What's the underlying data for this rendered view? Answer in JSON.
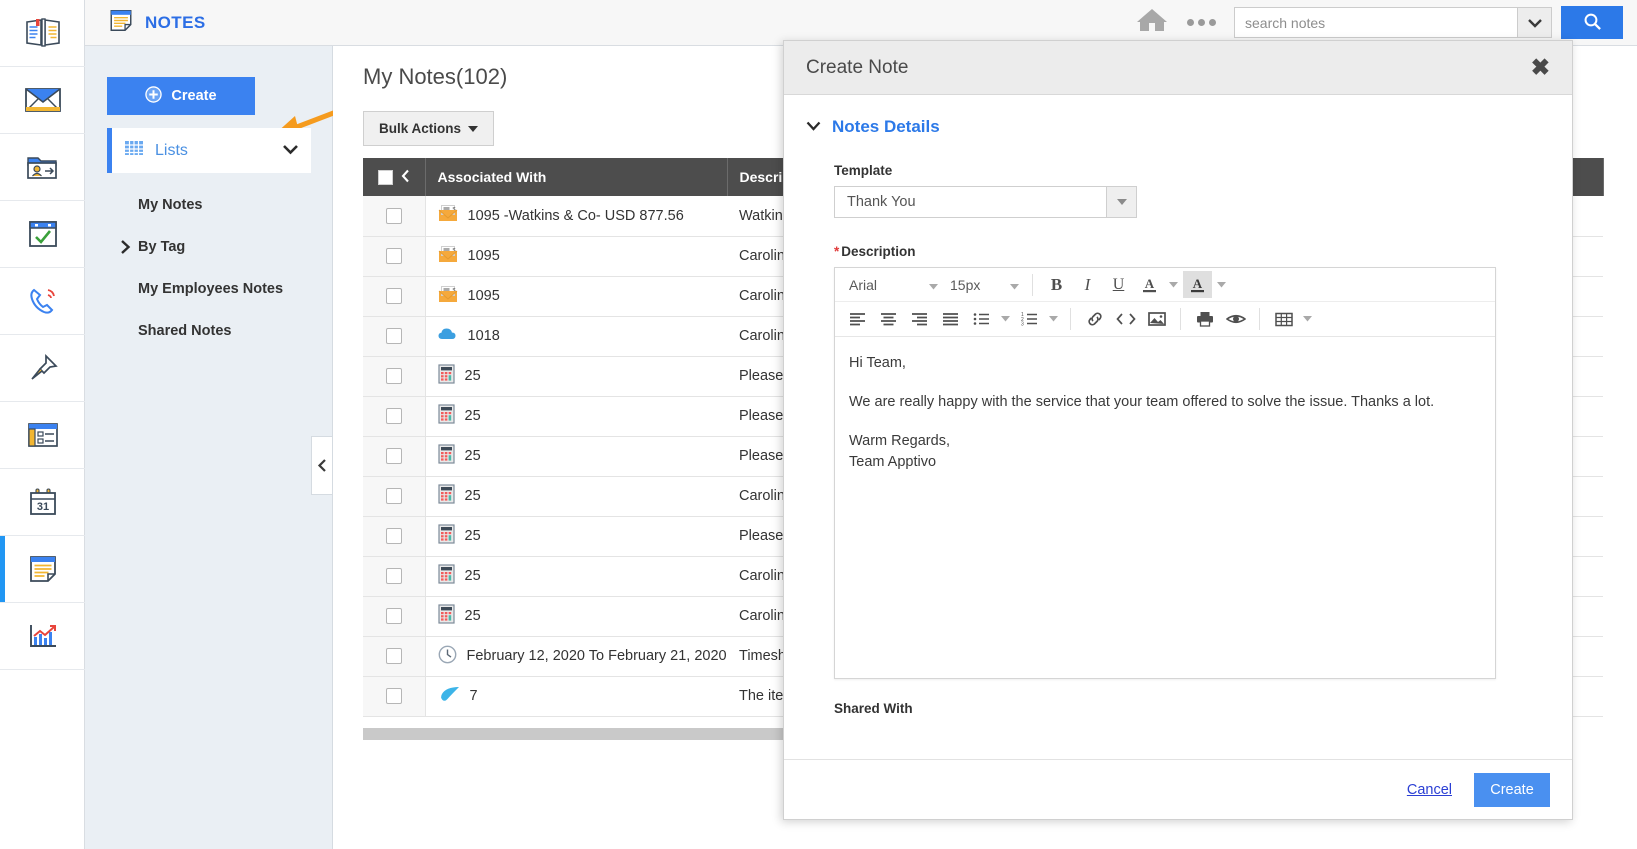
{
  "rail": {
    "items": [
      {
        "name": "directory-icon",
        "label": "Directory"
      },
      {
        "name": "mail-icon",
        "label": "Email"
      },
      {
        "name": "contacts-transfer-icon",
        "label": "Contacts"
      },
      {
        "name": "tasks-icon",
        "label": "Tasks"
      },
      {
        "name": "calls-icon",
        "label": "Calls"
      },
      {
        "name": "pin-icon",
        "label": "Pinned"
      },
      {
        "name": "newsletter-icon",
        "label": "News"
      },
      {
        "name": "calendar-icon",
        "label": "Calendar"
      },
      {
        "name": "notes-icon",
        "label": "Notes"
      },
      {
        "name": "reports-icon",
        "label": "Reports"
      }
    ],
    "active_index": 8
  },
  "header": {
    "app_name": "NOTES",
    "home_label": "Home",
    "more_label": "More",
    "accent_color": "#2c6ee5"
  },
  "search": {
    "value": "",
    "placeholder": "search notes",
    "button_label": "Search"
  },
  "sidebar": {
    "create_label": "Create",
    "lists_label": "Lists",
    "items": [
      {
        "label": "My Notes",
        "expandable": false
      },
      {
        "label": "By Tag",
        "expandable": true
      },
      {
        "label": "My Employees Notes",
        "expandable": false
      },
      {
        "label": "Shared Notes",
        "expandable": false
      }
    ]
  },
  "main": {
    "page_title": "My Notes(102)",
    "bulk_actions_label": "Bulk Actions"
  },
  "table": {
    "columns": [
      "Associated With",
      "Description"
    ],
    "rows": [
      {
        "icon": "invoice-envelope-icon",
        "associated": "1095 -Watkins & Co- USD 877.56",
        "description": "Watkins"
      },
      {
        "icon": "invoice-envelope-icon",
        "associated": "1095",
        "description": "Caroline"
      },
      {
        "icon": "invoice-envelope-icon",
        "associated": "1095",
        "description": "Caroline"
      },
      {
        "icon": "cloud-icon",
        "associated": "1018",
        "description": "Caroline"
      },
      {
        "icon": "calculator-icon",
        "associated": "25",
        "description": "Please r"
      },
      {
        "icon": "calculator-icon",
        "associated": "25",
        "description": "Please r"
      },
      {
        "icon": "calculator-icon",
        "associated": "25",
        "description": "Please r"
      },
      {
        "icon": "calculator-icon",
        "associated": "25",
        "description": "Caroline"
      },
      {
        "icon": "calculator-icon",
        "associated": "25",
        "description": "Please r"
      },
      {
        "icon": "calculator-icon",
        "associated": "25",
        "description": "Caroline"
      },
      {
        "icon": "calculator-icon",
        "associated": "25",
        "description": "Caroline"
      },
      {
        "icon": "clock-icon",
        "associated": "February 12, 2020 To February 21, 2020",
        "description": "Timeshe"
      },
      {
        "icon": "leaf-icon",
        "associated": "7",
        "description": "The item"
      }
    ]
  },
  "modal": {
    "title": "Create Note",
    "close_label": "✖",
    "section_title": "Notes Details",
    "template_label": "Template",
    "template_value": "Thank You",
    "description_label": "Description",
    "description_required": "*",
    "shared_with_label": "Shared With",
    "cancel_label": "Cancel",
    "create_label": "Create",
    "editor": {
      "font_family": "Arial",
      "font_size": "15px",
      "body_lines": [
        "Hi Team,",
        "We are really happy with the service that your team offered to solve the issue. Thanks a lot.",
        "Warm Regards,",
        "Team Apptivo"
      ],
      "toolbar_row1": [
        {
          "name": "bold-icon",
          "glyph": "B",
          "active": false
        },
        {
          "name": "italic-icon",
          "glyph": "I",
          "active": false
        },
        {
          "name": "underline-icon",
          "glyph": "U",
          "active": false
        },
        {
          "name": "font-color-icon",
          "glyph": "A",
          "active": false
        },
        {
          "name": "highlight-color-icon",
          "glyph": "A",
          "active": true
        }
      ],
      "toolbar_row2": [
        {
          "name": "align-left-icon"
        },
        {
          "name": "align-center-icon"
        },
        {
          "name": "align-right-icon"
        },
        {
          "name": "align-justify-icon"
        },
        {
          "name": "bullet-list-icon"
        },
        {
          "name": "numbered-list-icon"
        },
        {
          "name": "link-icon"
        },
        {
          "name": "source-code-icon"
        },
        {
          "name": "insert-image-icon"
        },
        {
          "name": "print-icon"
        },
        {
          "name": "preview-icon"
        },
        {
          "name": "table-icon"
        }
      ]
    }
  },
  "colors": {
    "primary_blue": "#3b82f0",
    "link_blue": "#2c79e8",
    "sidebar_bg": "#eaeff4",
    "table_header": "#4d4d4d",
    "annotation_orange": "#f59b1e"
  }
}
